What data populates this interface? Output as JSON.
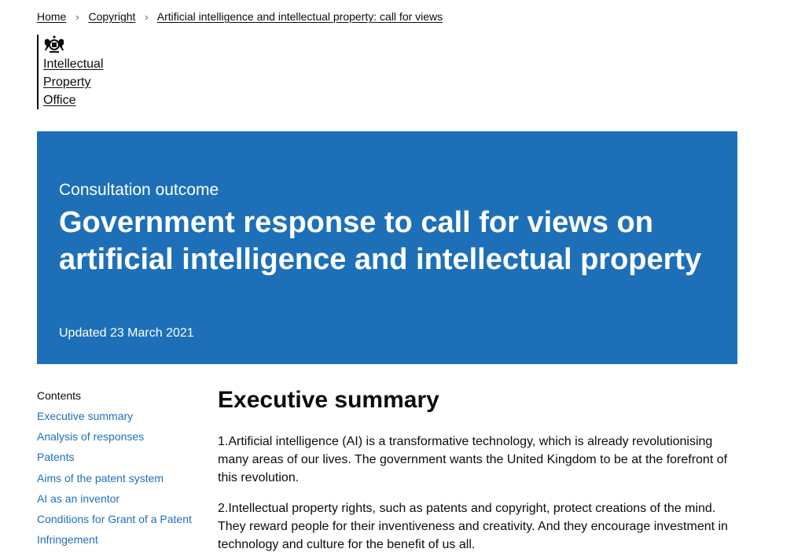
{
  "breadcrumb": {
    "items": [
      "Home",
      "Copyright",
      "Artificial intelligence and intellectual property: call for views"
    ],
    "separator": "›"
  },
  "organisation": {
    "name_lines": [
      "Intellectual",
      "Property",
      "Office"
    ]
  },
  "banner": {
    "type": "Consultation outcome",
    "title": "Government response to call for views on artificial intelligence and intellectual property",
    "updated": "Updated 23 March 2021",
    "background_color": "#1d70b8"
  },
  "contents": {
    "heading": "Contents",
    "items": [
      "Executive summary",
      "Analysis of responses",
      "Patents",
      "Aims of the patent system",
      "AI as an inventor",
      "Conditions for Grant of a Patent",
      "Infringement"
    ],
    "link_color": "#1d70b8"
  },
  "main": {
    "heading": "Executive summary",
    "paragraphs": [
      "1.Artificial intelligence (AI) is a transformative technology, which is already revolutionising many areas of our lives. The government wants the United Kingdom to be at the forefront of this revolution.",
      "2.Intellectual property rights, such as patents and copyright, protect creations of the mind. They reward people for their inventiveness and creativity. And they encourage investment in technology and culture for the benefit of us all."
    ]
  }
}
